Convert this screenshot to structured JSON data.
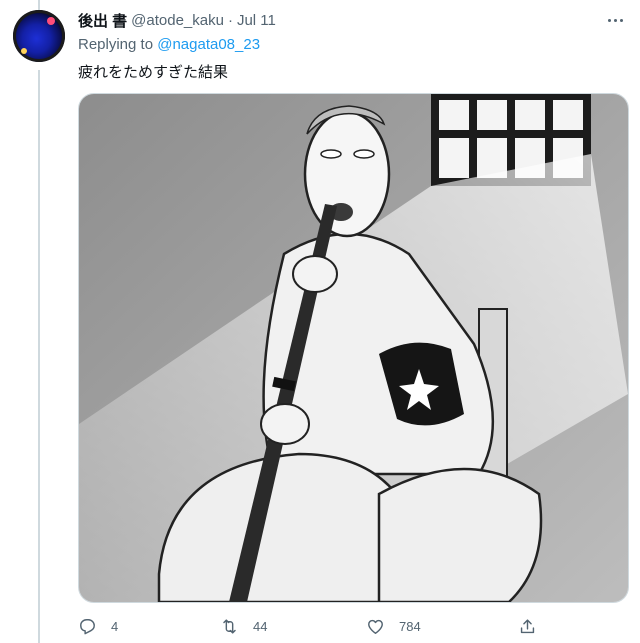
{
  "tweet": {
    "display_name": "後出 書",
    "handle": "@atode_kaku",
    "separator": "·",
    "date": "Jul 11",
    "replying_prefix": "Replying to",
    "replying_to": "@nagata08_23",
    "text": "疲れをためすぎた結果"
  },
  "actions": {
    "replies": "4",
    "retweets": "44",
    "likes": "784"
  },
  "icons": {
    "more": "more-horizontal-icon",
    "reply": "reply-icon",
    "retweet": "retweet-icon",
    "like": "heart-icon",
    "share": "share-icon"
  },
  "colors": {
    "link": "#1d9bf0",
    "secondary_text": "#536471",
    "primary_text": "#0f1419",
    "border": "#cfd9de"
  }
}
